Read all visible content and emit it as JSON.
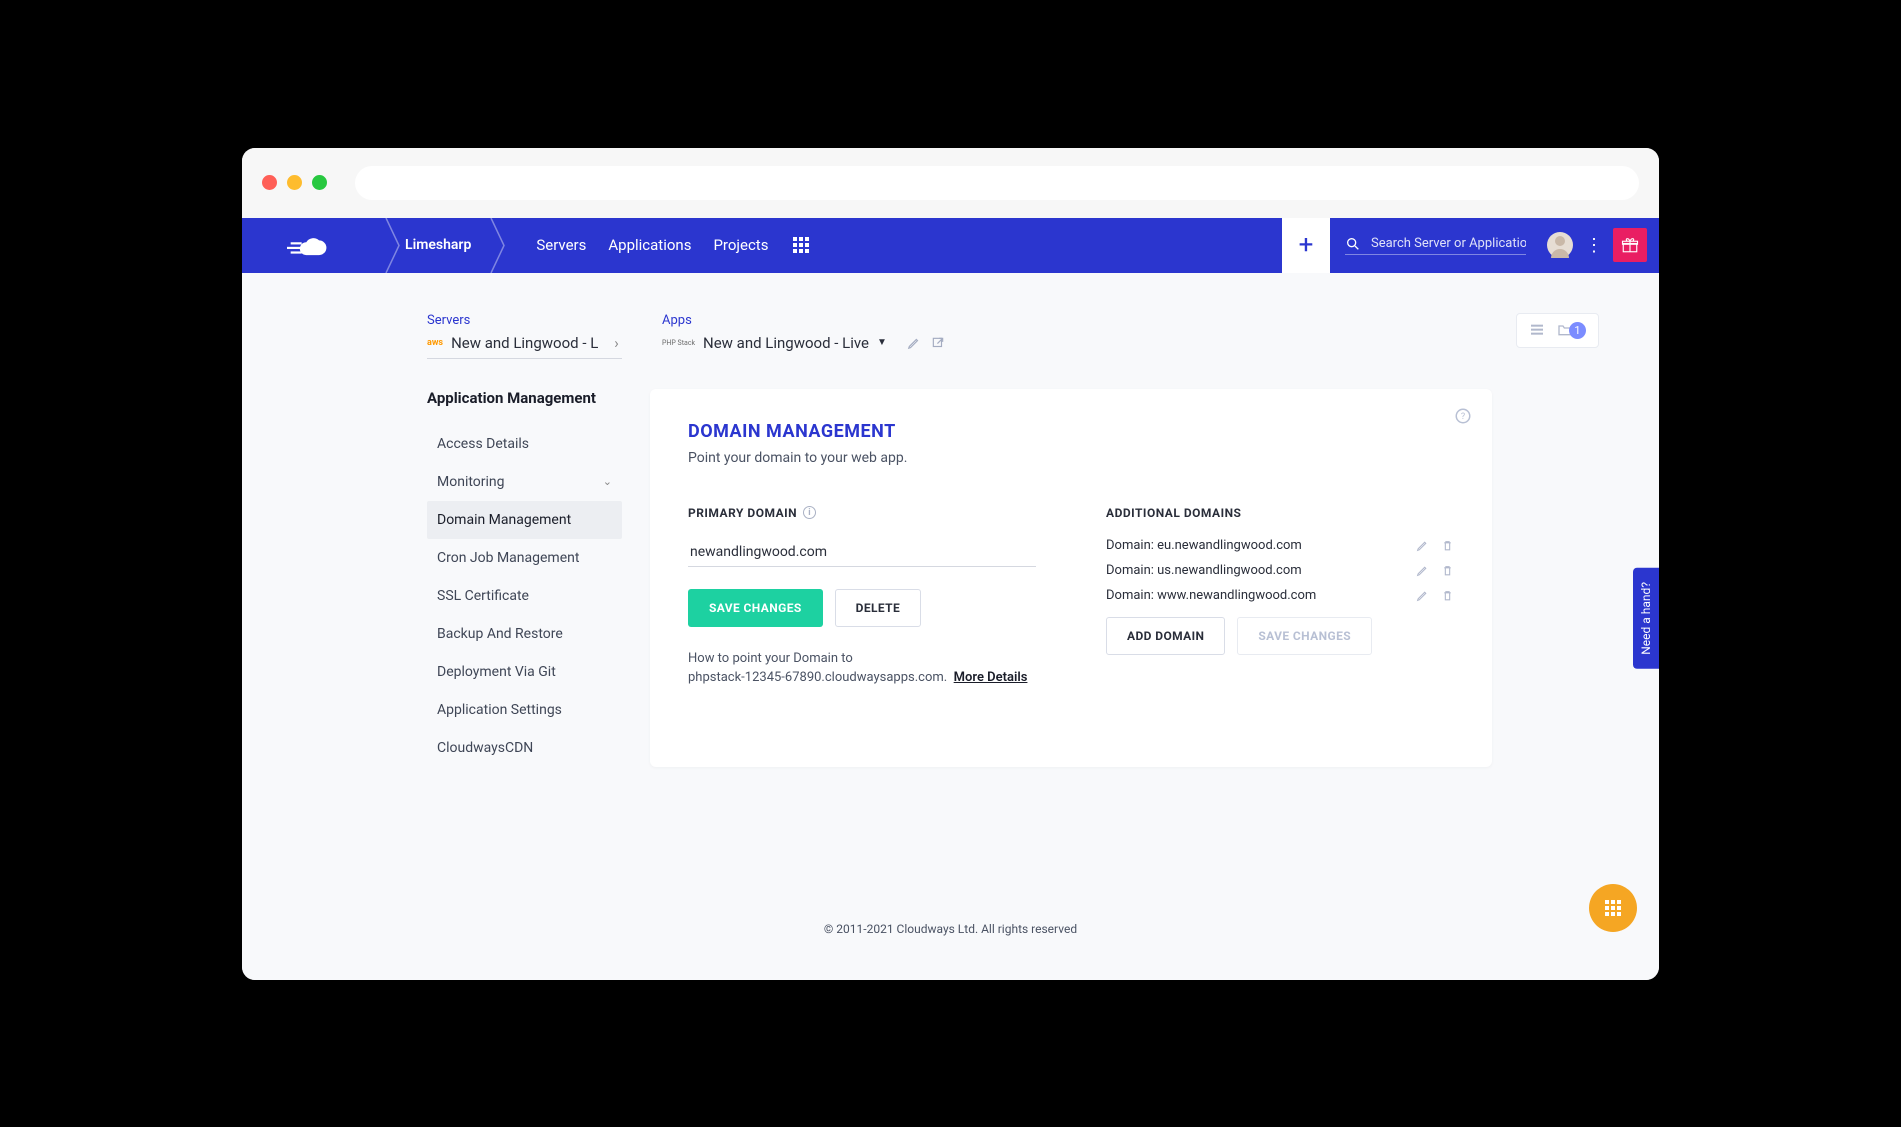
{
  "topbar": {
    "org": "Limesharp",
    "nav": {
      "servers": "Servers",
      "applications": "Applications",
      "projects": "Projects"
    },
    "search_placeholder": "Search Server or Application",
    "add_label": "+"
  },
  "crumbs": {
    "servers_label": "Servers",
    "server_name": "New and Lingwood - L",
    "apps_label": "Apps",
    "app_name": "New and Lingwood - Live",
    "badge_count": "1"
  },
  "sidebar": {
    "title": "Application Management",
    "items": [
      "Access Details",
      "Monitoring",
      "Domain Management",
      "Cron Job Management",
      "SSL Certificate",
      "Backup And Restore",
      "Deployment Via Git",
      "Application Settings",
      "CloudwaysCDN"
    ]
  },
  "card": {
    "title": "DOMAIN MANAGEMENT",
    "subtitle": "Point your domain to your web app.",
    "primary_label": "PRIMARY DOMAIN",
    "primary_value": "newandlingwood.com",
    "save": "SAVE CHANGES",
    "delete": "DELETE",
    "help1": "How to point your Domain to",
    "help2": "phpstack-12345-67890.cloudwaysapps.com.",
    "more": "More Details",
    "additional_label": "ADDITIONAL DOMAINS",
    "domain_prefix": "Domain:",
    "domains": [
      "eu.newandlingwood.com",
      "us.newandlingwood.com",
      "www.newandlingwood.com"
    ],
    "add_domain": "ADD DOMAIN",
    "save_changes_secondary": "SAVE CHANGES"
  },
  "need_hand": "Need a hand?",
  "footer": "© 2011-2021 Cloudways Ltd. All rights reserved"
}
